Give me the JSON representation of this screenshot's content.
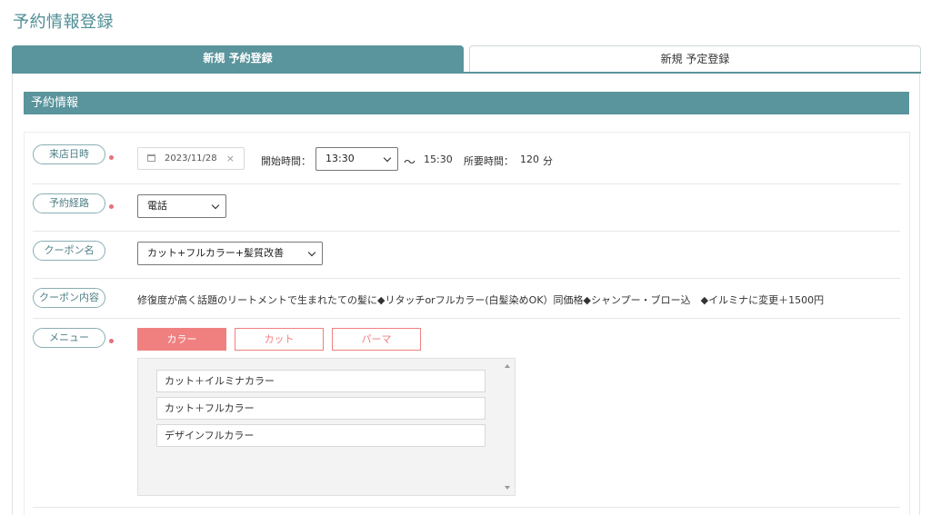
{
  "page": {
    "title": "予約情報登録"
  },
  "tabs": [
    {
      "label": "新規 予約登録",
      "active": true
    },
    {
      "label": "新規 予定登録",
      "active": false
    }
  ],
  "section": {
    "title": "予約情報"
  },
  "form": {
    "visit_datetime": {
      "label": "来店日時",
      "date": "2023/11/28",
      "clear": "×",
      "start_label": "開始時間：",
      "start_value": "13:30",
      "tilde": "〜",
      "end_value": "15:30",
      "duration_label": "所要時間：",
      "duration_value": "120",
      "duration_unit": "分"
    },
    "route": {
      "label": "予約経路",
      "value": "電話"
    },
    "coupon_name": {
      "label": "クーポン名",
      "value": "カット+フルカラー+髪質改善"
    },
    "coupon_content": {
      "label": "クーポン内容",
      "text": "修復度が高く話題のリートメントで生まれたての髪に◆リタッチorフルカラー(白髪染めOK）同価格◆シャンプー・ブロー込　◆イルミナに変更＋1500円"
    },
    "menu": {
      "label": "メニュー",
      "tabs": [
        "カラー",
        "カット",
        "パーマ"
      ],
      "items": [
        "カット＋イルミナカラー",
        "カット＋フルカラー",
        "デザインフルカラー"
      ]
    }
  },
  "colors": {
    "accent": "#5a949c",
    "required": "#e8707a",
    "menu_active": "#f08080"
  }
}
